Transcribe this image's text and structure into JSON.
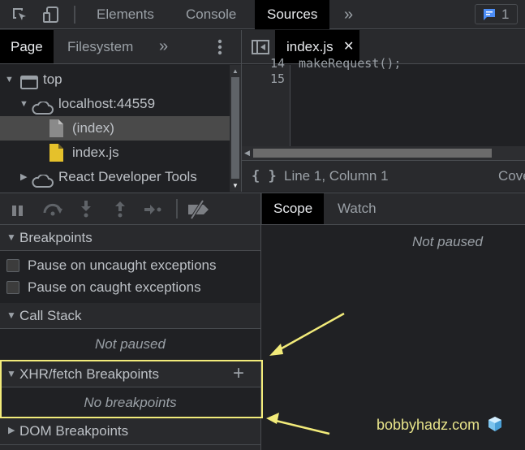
{
  "toolbar": {
    "tabs": [
      {
        "label": "Elements",
        "active": false
      },
      {
        "label": "Console",
        "active": false
      },
      {
        "label": "Sources",
        "active": true
      }
    ],
    "more_tabs_label": "»",
    "issues_count": "1",
    "icons": [
      "inspect-element-icon",
      "device-toolbar-icon",
      "chevron-double-right-icon",
      "issues-message-icon"
    ]
  },
  "navigator": {
    "tabs": [
      {
        "label": "Page",
        "active": true
      },
      {
        "label": "Filesystem",
        "active": false
      }
    ],
    "more_label": "»",
    "tree": [
      {
        "label": "top",
        "icon": "frame-icon",
        "expanded": true,
        "depth": 0
      },
      {
        "label": "localhost:44559",
        "icon": "cloud-icon",
        "expanded": true,
        "depth": 1
      },
      {
        "label": "(index)",
        "icon": "document-icon",
        "selected": true,
        "depth": 2
      },
      {
        "label": "index.js",
        "icon": "js-file-icon",
        "depth": 2
      },
      {
        "label": "React Developer Tools",
        "icon": "cloud-icon",
        "expanded": false,
        "depth": 1
      }
    ]
  },
  "editor": {
    "open_tab": "index.js",
    "lines": [
      {
        "number": "14",
        "code": "makeRequest();"
      },
      {
        "number": "15",
        "code": ""
      }
    ],
    "status": {
      "position": "Line 1, Column 1",
      "coverage": "Coverage: n/a",
      "pretty_print_label": "{ }"
    }
  },
  "debugger": {
    "sections": {
      "breakpoints": {
        "title": "Breakpoints",
        "options": [
          {
            "label": "Pause on uncaught exceptions",
            "checked": false
          },
          {
            "label": "Pause on caught exceptions",
            "checked": false
          }
        ]
      },
      "call_stack": {
        "title": "Call Stack",
        "placeholder": "Not paused"
      },
      "xhr_breakpoints": {
        "title": "XHR/fetch Breakpoints",
        "placeholder": "No breakpoints",
        "add_label": "+"
      },
      "dom_breakpoints": {
        "title": "DOM Breakpoints"
      }
    },
    "scope_tabs": [
      {
        "label": "Scope",
        "active": true
      },
      {
        "label": "Watch",
        "active": false
      }
    ],
    "scope_placeholder": "Not paused"
  },
  "annotation": {
    "watermark": "bobbyhadz.com",
    "highlight_color": "#f2eb7a"
  }
}
